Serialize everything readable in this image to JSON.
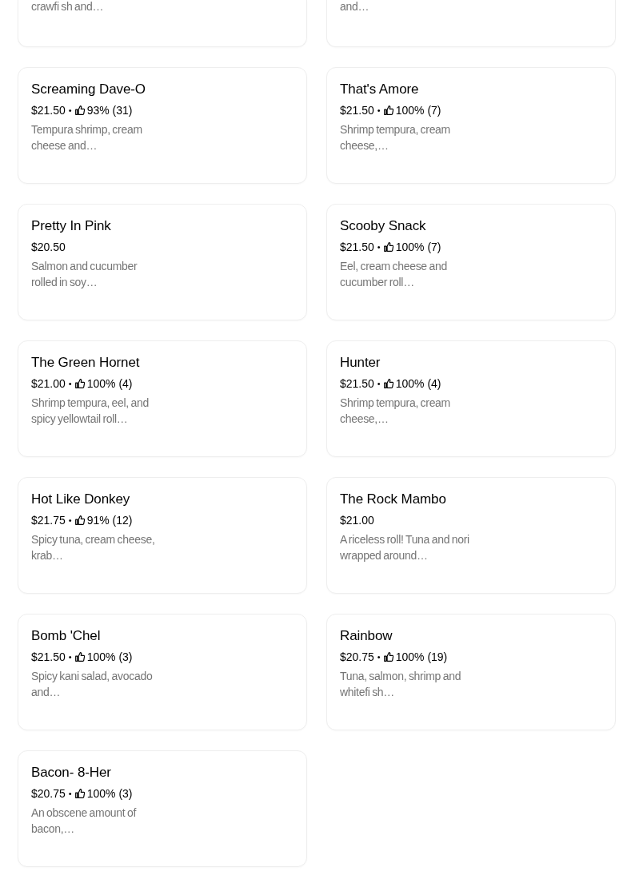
{
  "menu_items": [
    {
      "kind": "cut",
      "description": "crawfi sh and…"
    },
    {
      "kind": "cut",
      "description": "and…"
    },
    {
      "kind": "full",
      "name": "Screaming Dave-O",
      "price": "$21.50",
      "separator": "•",
      "rating": "93% (31)",
      "description": "Tempura shrimp, cream cheese and…"
    },
    {
      "kind": "full",
      "name": "That's Amore",
      "price": "$21.50",
      "separator": "•",
      "rating": "100% (7)",
      "description": "Shrimp tempura, cream cheese,…"
    },
    {
      "kind": "full",
      "name": "Pretty In Pink",
      "price": "$20.50",
      "description": "Salmon and cucumber rolled in soy…"
    },
    {
      "kind": "full",
      "name": "Scooby Snack",
      "price": "$21.50",
      "separator": "•",
      "rating": "100% (7)",
      "description": "Eel, cream cheese and cucumber roll…"
    },
    {
      "kind": "full",
      "name": "The Green Hornet",
      "price": "$21.00",
      "separator": "•",
      "rating": "100% (4)",
      "description": "Shrimp tempura, eel, and spicy yellowtail roll…"
    },
    {
      "kind": "full",
      "name": "Hunter",
      "price": "$21.50",
      "separator": "•",
      "rating": "100% (4)",
      "description": "Shrimp tempura, cream cheese,…"
    },
    {
      "kind": "full",
      "name": "Hot Like Donkey",
      "price": "$21.75",
      "separator": "•",
      "rating": "91% (12)",
      "description": "Spicy tuna, cream cheese, krab…"
    },
    {
      "kind": "full",
      "name": "The Rock Mambo",
      "price": "$21.00",
      "description": "A riceless roll! Tuna and nori wrapped around…"
    },
    {
      "kind": "full",
      "name": "Bomb 'Chel",
      "price": "$21.50",
      "separator": "•",
      "rating": "100% (3)",
      "description": "Spicy kani salad, avocado and…"
    },
    {
      "kind": "full",
      "name": "Rainbow",
      "price": "$20.75",
      "separator": "•",
      "rating": "100% (19)",
      "description": "Tuna, salmon, shrimp and whitefi sh…"
    },
    {
      "kind": "full",
      "name": "Bacon- 8-Her",
      "price": "$20.75",
      "separator": "•",
      "rating": "100% (3)",
      "description": "An obscene amount of bacon,…"
    }
  ]
}
